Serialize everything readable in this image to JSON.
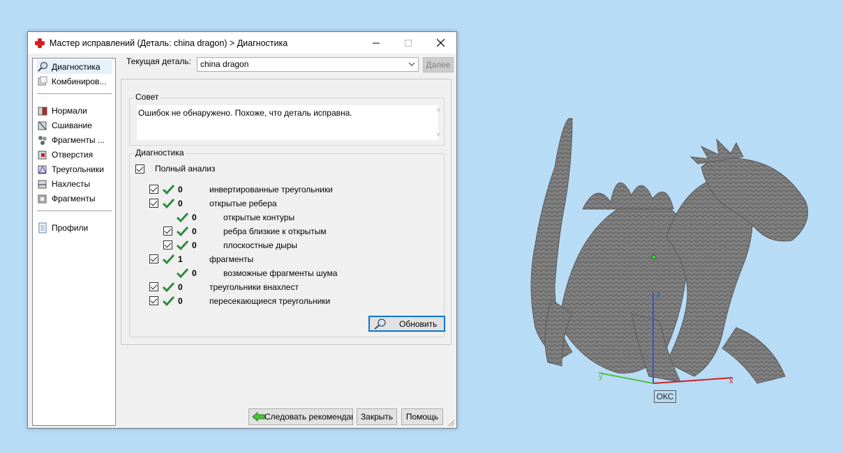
{
  "dialog": {
    "title": "Мастер исправлений (Деталь: china dragon) > Диагностика",
    "current_part_label": "Текущая деталь:",
    "current_part_value": "china dragon",
    "next_label": "Далее"
  },
  "sidebar": {
    "items": [
      {
        "label": "Диагностика",
        "icon": "magnifier-icon"
      },
      {
        "label": "Комбиниров...",
        "icon": "combine-icon"
      },
      {
        "label": "Нормали",
        "icon": "normals-icon"
      },
      {
        "label": "Сшивание",
        "icon": "stitch-icon"
      },
      {
        "label": "Фрагменты ...",
        "icon": "fragments-icon"
      },
      {
        "label": "Отверстия",
        "icon": "holes-icon"
      },
      {
        "label": "Треугольники",
        "icon": "triangles-icon"
      },
      {
        "label": "Нахлесты",
        "icon": "overlaps-icon"
      },
      {
        "label": "Фрагменты",
        "icon": "shells-icon"
      },
      {
        "label": "Профили",
        "icon": "profile-icon"
      }
    ]
  },
  "tip": {
    "title": "Совет",
    "text": "Ошибок не обнаружено. Похоже, что деталь исправна."
  },
  "diagnostics": {
    "title": "Диагностика",
    "full_analysis_label": "Полный анализ",
    "rows": [
      {
        "count": "0",
        "label": "инвертированные треугольники"
      },
      {
        "count": "0",
        "label": "открытые ребера"
      },
      {
        "count": "0",
        "label": "открытые контуры"
      },
      {
        "count": "0",
        "label": "ребра близкие к открытым"
      },
      {
        "count": "0",
        "label": "плоскостные дыры"
      },
      {
        "count": "1",
        "label": "фрагменты"
      },
      {
        "count": "0",
        "label": "возможные фрагменты шума"
      },
      {
        "count": "0",
        "label": "треугольники внахлест"
      },
      {
        "count": "0",
        "label": "пересекающиеся треугольники"
      }
    ],
    "refresh_label": "Обновить"
  },
  "buttons": {
    "follow_label": "Следовать рекомендациям",
    "close_label": "Закрыть",
    "help_label": "Помощь"
  },
  "viewport": {
    "cs_label": "ОКС",
    "axis_labels": {
      "x": "x",
      "y": "y",
      "z": "z"
    }
  },
  "colors": {
    "background": "#b9dcf6",
    "check_green": "#2e8b3a",
    "model_gray": "#7d7d7d",
    "axis_x": "#d02020",
    "axis_y": "#4ec03a",
    "axis_z": "#2d56d0"
  }
}
